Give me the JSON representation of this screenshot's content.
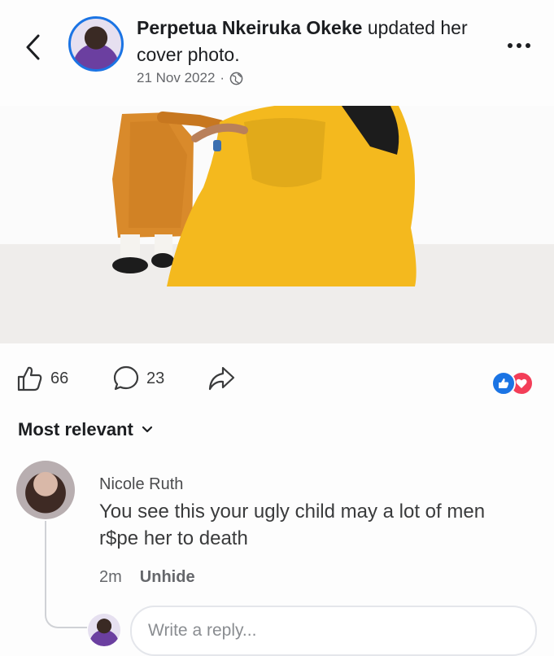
{
  "post": {
    "author": "Perpetua Nkeiruka Okeke",
    "action": " updated her cover photo.",
    "date": "21 Nov 2022",
    "separator": "·",
    "privacy_icon": "globe-icon"
  },
  "stats": {
    "likes": "66",
    "comments": "23",
    "reaction_icons": [
      "like-reaction-icon",
      "love-reaction-icon"
    ]
  },
  "colors": {
    "accent": "#1b74e4",
    "love": "#f33e58",
    "dress": "#f4b91e",
    "child_outfit": "#d98a2b"
  },
  "comments": {
    "sort_label": "Most relevant",
    "items": [
      {
        "author": "Nicole Ruth",
        "text": "You see this your ugly child may a lot of men r$pe her to death",
        "time": "2m",
        "action": "Unhide"
      }
    ],
    "reply_placeholder": "Write a reply..."
  }
}
